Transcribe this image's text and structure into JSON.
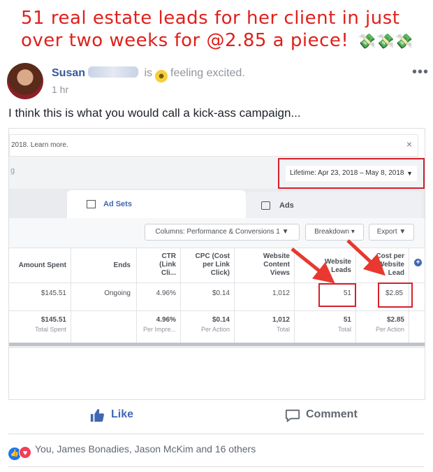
{
  "headline": "51 real estate leads for her client in just over two weeks for @2.85 a piece!",
  "headline_emoji": "💸💸💸",
  "post": {
    "author": "Susan",
    "status_prefix": "is",
    "status_text": "feeling excited.",
    "time": "1 hr",
    "more": "•••",
    "text": "I think this is what you would call a kick-ass campaign..."
  },
  "screenshot": {
    "notice": "2018. Learn more.",
    "close": "×",
    "g_char": "g",
    "lifetime": "Lifetime: Apr 23, 2018 – May 8, 2018",
    "tabs": {
      "ad_sets": "Ad Sets",
      "ads": "Ads"
    },
    "buttons": {
      "columns": "Columns: Performance & Conversions 1",
      "breakdown": "Breakdown",
      "export": "Export"
    },
    "columns": {
      "amount_spent": "Amount Spent",
      "ends": "Ends",
      "ctr": [
        "CTR",
        "(Link",
        "Cli..."
      ],
      "cpc": [
        "CPC (Cost",
        "per Link",
        "Click)"
      ],
      "content_views": [
        "Website",
        "Content",
        "Views"
      ],
      "leads": [
        "Website",
        "Leads"
      ],
      "cost_per_lead": [
        "Cost per",
        "Website",
        "Lead"
      ]
    },
    "row": {
      "amount_spent": "$145.51",
      "ends": "Ongoing",
      "ctr": "4.96%",
      "cpc": "$0.14",
      "content_views": "1,012",
      "leads": "51",
      "cost_per_lead": "$2.85"
    },
    "totals": {
      "amount_spent": "$145.51",
      "amount_spent_sub": "Total Spent",
      "ctr": "4.96%",
      "ctr_sub": "Per Impre...",
      "cpc": "$0.14",
      "cpc_sub": "Per Action",
      "content_views": "1,012",
      "content_views_sub": "Total",
      "leads": "51",
      "leads_sub": "Total",
      "cost_per_lead": "$2.85",
      "cost_per_lead_sub": "Per Action"
    }
  },
  "actions": {
    "like": "Like",
    "comment": "Comment"
  },
  "reactions": {
    "text": "You, James Bonadies, Jason McKim and 16 others"
  },
  "colors": {
    "headline": "#e0201b",
    "brand_blue": "#4267b2",
    "highlight_red": "#d6202b"
  }
}
